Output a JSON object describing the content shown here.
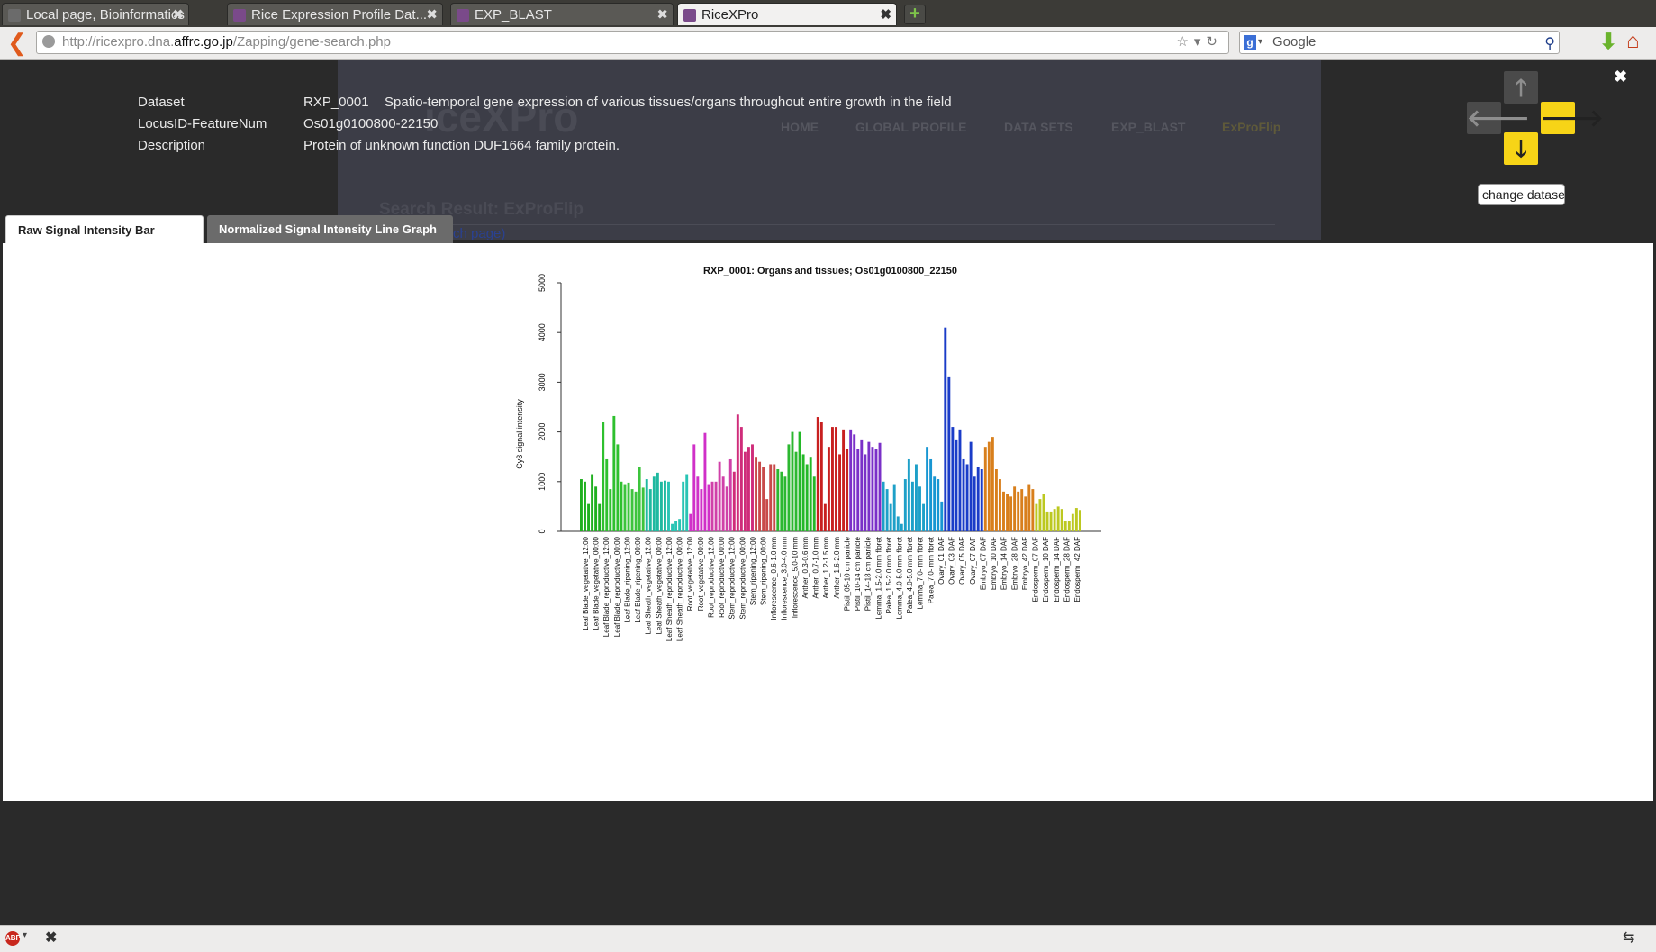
{
  "browser": {
    "tabs": [
      {
        "title": "Local page, Bioinformatics ...",
        "active": false
      },
      {
        "title": "Rice Expression Profile Dat...",
        "active": false
      },
      {
        "title": "EXP_BLAST",
        "active": false
      },
      {
        "title": "RiceXPro",
        "active": true
      }
    ],
    "url_prefix": "http://ricexpro.dna.",
    "url_host": "affrc.go.jp",
    "url_path": "/Zapping/gene-search.php",
    "search_placeholder": "Google"
  },
  "background_page": {
    "logo": "iceXPro",
    "nav": [
      "HOME",
      "GLOBAL PROFILE",
      "DATA SETS",
      "EXP_BLAST",
      "ExProFlip"
    ],
    "title": "Search Result: ExProFlip",
    "link": "rch page)"
  },
  "info": {
    "dataset_label": "Dataset",
    "dataset_id": "RXP_0001",
    "dataset_desc": "Spatio-temporal gene expression of various tissues/organs throughout entire growth in the field",
    "locus_label": "LocusID-FeatureNum",
    "locus_value": "Os01g0100800-22150",
    "description_label": "Description",
    "description_value": "Protein of unknown function DUF1664 family protein."
  },
  "tooltip": "change dataset",
  "graph_tabs": [
    "Raw Signal Intensity Bar Graph",
    "Normalized Signal Intensity Line Graph"
  ],
  "chart_data": {
    "type": "bar",
    "title": "RXP_0001: Organs and tissues; Os01g0100800_22150",
    "xlabel": "",
    "ylabel": "Cy3 signal intensity",
    "ylim": [
      0,
      5000
    ],
    "yticks": [
      0,
      1000,
      2000,
      3000,
      4000,
      5000
    ],
    "grid": false,
    "legend": "none",
    "category_labels": [
      "Leaf Blade_vegetative_12:00",
      "Leaf Blade_vegetative_00:00",
      "Leaf Blade_reproductive_12:00",
      "Leaf Blade_reproductive_00:00",
      "Leaf Blade_ripening_12:00",
      "Leaf Blade_ripening_00:00",
      "Leaf Sheath_vegetative_12:00",
      "Leaf Sheath_vegetative_00:00",
      "Leaf Sheath_reproductive_12:00",
      "Leaf Sheath_reproductive_00:00",
      "Root_vegetative_12:00",
      "Root_vegetative_00:00",
      "Root_reproductive_12:00",
      "Root_reproductive_00:00",
      "Stem_reproductive_12:00",
      "Stem_reproductive_00:00",
      "Stem_ripening_12:00",
      "Stem_ripening_00:00",
      "Inflorescence_0.6-1.0 mm",
      "Inflorescence_3.0-4.0 mm",
      "Inflorescence_5.0-10 mm",
      "Anther_0.3-0.6 mm",
      "Anther_0.7-1.0 mm",
      "Anther_1.2-1.5 mm",
      "Anther_1.6-2.0 mm",
      "Pistil_05-10 cm panicle",
      "Pistil_10-14 cm panicle",
      "Pistil_14-18 cm panicle",
      "Lemma_1.5-2.0 mm floret",
      "Palea_1.5-2.0 mm floret",
      "Lemma_4.0-5.0 mm floret",
      "Palea_4.0-5.0 mm floret",
      "Lemma_7.0- mm floret",
      "Palea_7.0- mm floret",
      "Ovary_01 DAF",
      "Ovary_03 DAF",
      "Ovary_05 DAF",
      "Ovary_07 DAF",
      "Embryo_07 DAF",
      "Embryo_10 DAF",
      "Embryo_14 DAF",
      "Embryo_28 DAF",
      "Embryo_42 DAF",
      "Endosperm_07 DAF",
      "Endosperm_10 DAF",
      "Endosperm_14 DAF",
      "Endosperm_28 DAF",
      "Endosperm_42 DAF"
    ],
    "groups": [
      {
        "color": "#1fb01f",
        "values": [
          1050,
          1000,
          550,
          1150,
          900,
          550
        ]
      },
      {
        "color": "#2ec02e",
        "values": [
          2200,
          1450,
          850,
          2320,
          1750,
          1000
        ]
      },
      {
        "color": "#3cc43c",
        "values": [
          950,
          980,
          850,
          800,
          1300,
          880
        ]
      },
      {
        "color": "#1fb9a0",
        "values": [
          1050,
          850,
          1100,
          1180,
          1000,
          1020
        ]
      },
      {
        "color": "#28c4b4",
        "values": [
          1000,
          150,
          200,
          250,
          1000,
          1150
        ]
      },
      {
        "color": "#d030c8",
        "values": [
          350,
          1750,
          1100,
          850,
          1980,
          950
        ]
      },
      {
        "color": "#d040a8",
        "values": [
          1000,
          1000,
          1400,
          1100,
          900,
          1450
        ]
      },
      {
        "color": "#cf2c7a",
        "values": [
          1200,
          2350,
          2100,
          1600,
          1700,
          1750
        ]
      },
      {
        "color": "#c84a4a",
        "values": [
          1500,
          1400,
          1300,
          650,
          1350,
          1350
        ]
      },
      {
        "color": "#2cb830",
        "values": [
          1250,
          1200,
          1100,
          1750,
          2000,
          1600
        ]
      },
      {
        "color": "#24b828",
        "values": [
          2000,
          1550,
          1350,
          1500,
          1100
        ]
      },
      {
        "color": "#c82020",
        "values": [
          2300,
          2200,
          550,
          1700,
          2100,
          2100,
          1550,
          2050,
          1650
        ]
      },
      {
        "color": "#7a30c8",
        "values": [
          2050,
          1950,
          1650,
          1850,
          1550,
          1800,
          1700,
          1650,
          1780
        ]
      },
      {
        "color": "#1ea0c8",
        "values": [
          1000,
          850,
          550,
          950,
          300,
          150,
          1050,
          1450,
          1000,
          1350,
          900,
          550
        ]
      },
      {
        "color": "#1896d2",
        "values": [
          1700,
          1450,
          1100,
          1050,
          600
        ]
      },
      {
        "color": "#1a3cc8",
        "values": [
          4100,
          3100,
          2100,
          1850,
          2050,
          1450,
          1350,
          1800,
          1100,
          1300,
          1250
        ]
      },
      {
        "color": "#d87f1c",
        "values": [
          1700,
          1800,
          1900,
          1250,
          1050,
          800,
          750,
          700,
          900,
          800,
          850,
          700,
          950,
          850
        ]
      },
      {
        "color": "#bcc820",
        "values": [
          550,
          650,
          750,
          400,
          400,
          450,
          500,
          450,
          200,
          200,
          350,
          470,
          430
        ]
      }
    ]
  }
}
